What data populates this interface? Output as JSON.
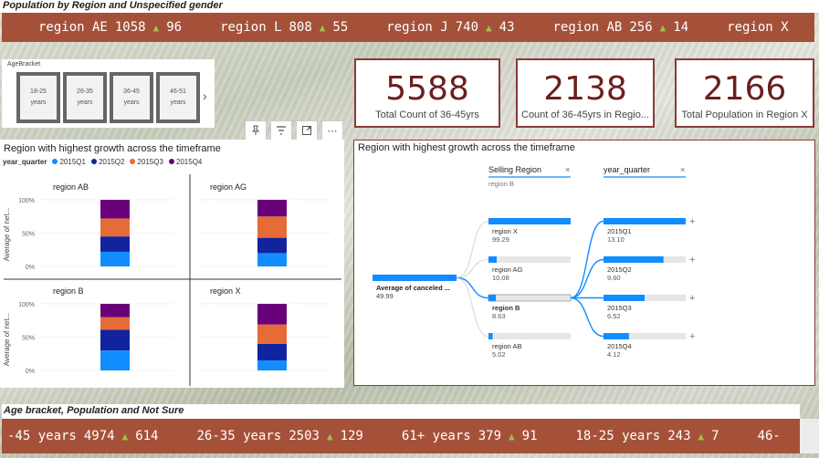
{
  "top": {
    "title": "Population by Region and Unspecified gender",
    "ticker": [
      {
        "label": "region AE",
        "value": "1058",
        "delta": "96"
      },
      {
        "label": "region L",
        "value": "808",
        "delta": "55"
      },
      {
        "label": "region J",
        "value": "740",
        "delta": "43"
      },
      {
        "label": "region AB",
        "value": "256",
        "delta": "14"
      },
      {
        "label": "region X",
        "value": "",
        "delta": ""
      }
    ]
  },
  "age_slicer": {
    "label": "AgeBracket",
    "options": [
      {
        "line1": "18-25",
        "line2": "years"
      },
      {
        "line1": "26-35",
        "line2": "years"
      },
      {
        "line1": "36-45",
        "line2": "years"
      },
      {
        "line1": "46-51",
        "line2": "years"
      }
    ],
    "next_icon": "chevron-right-icon"
  },
  "kpis": [
    {
      "value": "5588",
      "label": "Total Count of 36-45yrs"
    },
    {
      "value": "2138",
      "label": "Count of 36-45yrs in Regio..."
    },
    {
      "value": "2166",
      "label": "Total Population in Region X"
    }
  ],
  "visual_header_icons": [
    "pin-icon",
    "filter-icon",
    "focus-mode-icon",
    "more-options-icon"
  ],
  "left_chart": {
    "title": "Region with highest growth across the timeframe",
    "legend_title": "year_quarter",
    "ylabel": "Average of net...",
    "chart_data": {
      "type": "bar",
      "stacked": "100%",
      "series_names": [
        "2015Q1",
        "2015Q2",
        "2015Q3",
        "2015Q4"
      ],
      "colors": [
        "#118dff",
        "#12239e",
        "#e66c37",
        "#6b007b"
      ],
      "yticks": [
        "0%",
        "50%",
        "100%"
      ],
      "ylim": [
        0,
        100
      ],
      "panels": [
        {
          "name": "region AB",
          "values": [
            22,
            23,
            27,
            28
          ]
        },
        {
          "name": "region AG",
          "values": [
            20,
            23,
            32,
            25
          ]
        },
        {
          "name": "region B",
          "values": [
            30,
            31,
            19,
            20
          ]
        },
        {
          "name": "region X",
          "values": [
            15,
            25,
            29,
            31
          ]
        }
      ]
    }
  },
  "right_chart": {
    "title": "Region with highest growth across the timeframe",
    "root": {
      "label": "Average of canceled ...",
      "value": "49.99"
    },
    "levels": [
      {
        "header": "Selling Region",
        "subtitle": "region B",
        "close_icon": "close-icon",
        "nodes": [
          {
            "label": "region X",
            "value": "99.29",
            "fill": 1.0
          },
          {
            "label": "region AG",
            "value": "10.08",
            "fill": 0.1
          },
          {
            "label": "region B",
            "value": "8.63",
            "fill": 0.09,
            "selected": true
          },
          {
            "label": "region AB",
            "value": "5.02",
            "fill": 0.05
          }
        ]
      },
      {
        "header": "year_quarter",
        "subtitle": "",
        "close_icon": "close-icon",
        "nodes": [
          {
            "label": "2015Q1",
            "value": "13.10",
            "fill": 1.0
          },
          {
            "label": "2015Q2",
            "value": "9.60",
            "fill": 0.73
          },
          {
            "label": "2015Q3",
            "value": "6.52",
            "fill": 0.5
          },
          {
            "label": "2015Q4",
            "value": "4.12",
            "fill": 0.31
          }
        ]
      }
    ],
    "expand_icon": "plus-icon"
  },
  "bottom": {
    "title": "Age bracket, Population and Not Sure",
    "ticker": [
      {
        "label": "-45 years",
        "value": "4974",
        "delta": "614"
      },
      {
        "label": "26-35 years",
        "value": "2503",
        "delta": "129"
      },
      {
        "label": "61+ years",
        "value": "379",
        "delta": "91"
      },
      {
        "label": "18-25 years",
        "value": "243",
        "delta": "7"
      },
      {
        "label": "46-",
        "value": "",
        "delta": ""
      }
    ]
  }
}
